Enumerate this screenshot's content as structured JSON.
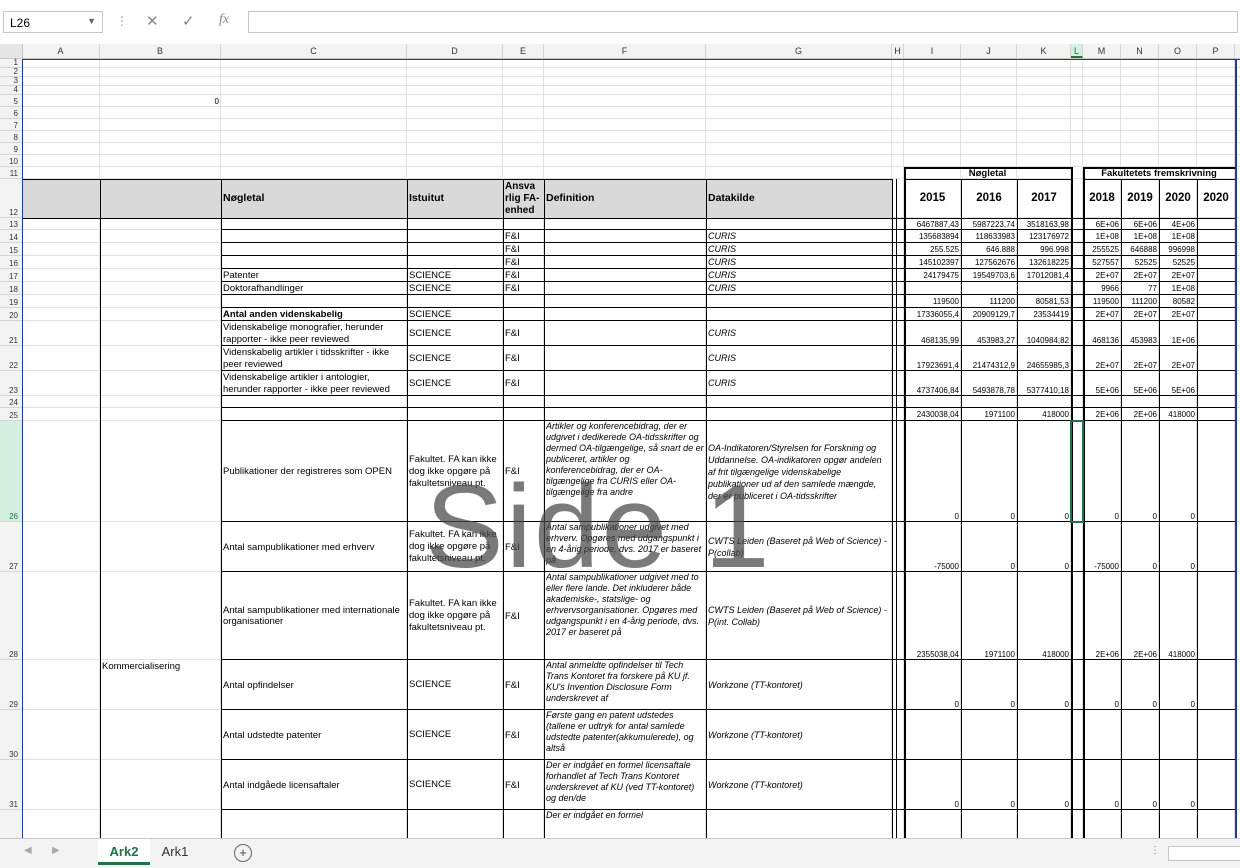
{
  "formula_bar": {
    "name_box": "L26",
    "formula": "",
    "fx_label": "fx"
  },
  "columns": [
    "A",
    "B",
    "C",
    "D",
    "E",
    "F",
    "G",
    "H",
    "I",
    "J",
    "K",
    "L",
    "M",
    "N",
    "O",
    "P"
  ],
  "rows": [
    "1",
    "2",
    "3",
    "4",
    "5",
    "6",
    "7",
    "8",
    "9",
    "10",
    "11",
    "12",
    "13",
    "14",
    "15",
    "16",
    "17",
    "18",
    "19",
    "20",
    "21",
    "22",
    "23",
    "24",
    "25",
    "26",
    "27",
    "28",
    "29",
    "30",
    "31"
  ],
  "b5_value": "0",
  "group_headers": {
    "noegletal": "Nøgletal",
    "fremskrivning": "Fakultetets fremskrivning"
  },
  "headers": {
    "c": "Nøgletal",
    "d": "Istuitut",
    "e": "Ansva rlig FA-enhed",
    "f": "Definition",
    "g": "Datakilde",
    "years": [
      "2015",
      "2016",
      "2017",
      "2018",
      "2019",
      "2020",
      "2020"
    ]
  },
  "data_rows": [
    {
      "c": "",
      "d": "",
      "e": "",
      "g": "",
      "i": "6467887,43",
      "j": "5987223,74",
      "k": "3518163,98",
      "m": "6E+06",
      "n": "6E+06",
      "o": "4E+06"
    },
    {
      "c": "",
      "d": "",
      "e": "F&I",
      "g": "CURIS",
      "i": "135683894",
      "j": "118633983",
      "k": "123176972",
      "m": "1E+08",
      "n": "1E+08",
      "o": "1E+08"
    },
    {
      "c": "",
      "d": "",
      "e": "F&I",
      "g": "CURIS",
      "i": "255.525",
      "j": "646.888",
      "k": "996.998",
      "m": "255525",
      "n": "646888",
      "o": "996998"
    },
    {
      "c": "",
      "d": "",
      "e": "F&I",
      "g": "CURIS",
      "i": "145102397",
      "j": "127562676",
      "k": "132618225",
      "m": "527557",
      "n": "52525",
      "o": "52525"
    },
    {
      "c": "Patenter",
      "d": "SCIENCE",
      "e": "F&I",
      "g": "CURIS",
      "i": "24179475",
      "j": "19549703,6",
      "k": "17012081,4",
      "m": "2E+07",
      "n": "2E+07",
      "o": "2E+07"
    },
    {
      "c": "Doktorafhandlinger",
      "d": "SCIENCE",
      "e": "F&I",
      "g": "CURIS",
      "i": "",
      "j": "",
      "k": "",
      "m": "9966",
      "n": "77",
      "o": "1E+08"
    },
    {
      "c": "",
      "d": "",
      "e": "",
      "g": "",
      "i": "119500",
      "j": "111200",
      "k": "80581,53",
      "m": "119500",
      "n": "111200",
      "o": "80582"
    },
    {
      "c": "Antal anden videnskabelig",
      "d": "SCIENCE",
      "e": "",
      "g": "",
      "i": "17336055,4",
      "j": "20909129,7",
      "k": "23534419",
      "m": "2E+07",
      "n": "2E+07",
      "o": "2E+07"
    },
    {
      "c": "Videnskabelige monografier, herunder rapporter - ikke peer reviewed",
      "d": "SCIENCE",
      "e": "F&I",
      "g": "CURIS",
      "i": "468135,99",
      "j": "453983,27",
      "k": "1040984,82",
      "m": "468136",
      "n": "453983",
      "o": "1E+06"
    },
    {
      "c": "Videnskabelig artikler i tidsskrifter - ikke peer reviewed",
      "d": "SCIENCE",
      "e": "F&I",
      "g": "CURIS",
      "i": "17923691,4",
      "j": "21474312,9",
      "k": "24655985,3",
      "m": "2E+07",
      "n": "2E+07",
      "o": "2E+07"
    },
    {
      "c": "Videnskabelige artikler i antologier, herunder rapporter - ikke peer reviewed",
      "d": "SCIENCE",
      "e": "F&I",
      "g": "CURIS",
      "i": "4737406,84",
      "j": "5493878,78",
      "k": "5377410,18",
      "m": "5E+06",
      "n": "5E+06",
      "o": "5E+06"
    },
    {
      "c": "",
      "d": "",
      "e": "",
      "g": "",
      "i": "",
      "j": "",
      "k": "",
      "m": "",
      "n": "",
      "o": ""
    },
    {
      "c": "",
      "d": "",
      "e": "",
      "g": "",
      "i": "2430038,04",
      "j": "1971100",
      "k": "418000",
      "m": "2E+06",
      "n": "2E+06",
      "o": "418000"
    }
  ],
  "tall_rows": [
    {
      "b": "",
      "c": "Publikationer der registreres som OPEN",
      "d": "Fakultet. FA kan ikke dog ikke opgøre på fakultetsniveau pt.",
      "e": "F&I",
      "f": "Artikler og konferencebidrag, der er udgivet i dedikerede OA-tidsskrifter og dermed OA-tilgængelige, så snart de er publiceret, artikler og konferencebidrag, der er OA-tilgængelige fra CURIS eller OA-tilgængelige fra andre",
      "g": "OA-Indikatoren/Styrelsen for Forskning og Uddannelse. OA-indikatoren opgør andelen af frit tilgængelige videnskabelige publikationer ud af den samlede mængde, der er publiceret i OA-tidsskrifter",
      "i": "0",
      "j": "0",
      "k": "0",
      "m": "0",
      "n": "0",
      "o": "0"
    },
    {
      "b": "",
      "c": "Antal sampublikationer med erhverv",
      "d": "Fakultet. FA kan ikke dog ikke opgøre på fakultetsniveau pt.",
      "e": "F&I",
      "f": "Antal sampublikationer udgivet med erhverv. Opgøres med udgangspunkt i en 4-årig periode, dvs. 2017 er baseret på",
      "g": "CWTS Leiden (Baseret på Web of Science) - P(collab)",
      "i": "-75000",
      "j": "0",
      "k": "0",
      "m": "-75000",
      "n": "0",
      "o": "0"
    },
    {
      "b": "",
      "c": "Antal sampublikationer med internationale organisationer",
      "d": "Fakultet. FA kan ikke dog ikke opgøre på fakultetsniveau pt.",
      "e": "F&I",
      "f": "Antal sampublikationer udgivet med to eller flere lande. Det inkluderer både akademiske-, statslige- og erhvervsorganisationer. Opgøres med udgangspunkt i en 4-årig periode, dvs. 2017 er baseret på",
      "g": "CWTS Leiden (Baseret på Web of Science) - P(int. Collab)",
      "i": "2355038,04",
      "j": "1971100",
      "k": "418000",
      "m": "2E+06",
      "n": "2E+06",
      "o": "418000"
    },
    {
      "b": "Kommercialisering",
      "c": "Antal opfindelser",
      "d": "SCIENCE",
      "e": "F&I",
      "f": "Antal anmeldte opfindelser til Tech Trans Kontoret fra forskere på KU jf. KU's Invention Disclosure Form underskrevet af",
      "g": "Workzone (TT-kontoret)",
      "i": "0",
      "j": "0",
      "k": "0",
      "m": "0",
      "n": "0",
      "o": "0"
    },
    {
      "b": "",
      "c": "Antal udstedte patenter",
      "d": "SCIENCE",
      "e": "F&I",
      "f": "Første gang en patent udstedes (tallene er udtryk for antal samlede udstedte patenter(akkumulerede), og altså",
      "g": "Workzone (TT-kontoret)",
      "i": "",
      "j": "",
      "k": "",
      "m": "",
      "n": "",
      "o": ""
    },
    {
      "b": "",
      "c": "Antal indgåede licensaftaler",
      "d": "SCIENCE",
      "e": "F&I",
      "f": "Der er indgået en formel licensaftale forhandlet af Tech Trans Kontoret underskrevet af KU (ved TT-kontoret) og den/de",
      "g": "Workzone (TT-kontoret)",
      "i": "0",
      "j": "0",
      "k": "0",
      "m": "0",
      "n": "0",
      "o": "0"
    }
  ],
  "row32_f": "Der er indgået en formel",
  "watermark": "Side 1",
  "sheet_tabs": [
    "Ark2",
    "Ark1"
  ],
  "active_tab": "Ark2"
}
